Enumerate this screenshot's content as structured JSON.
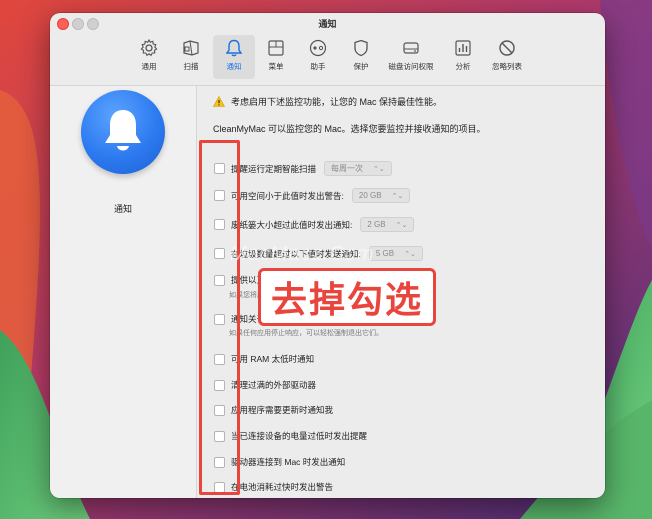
{
  "window": {
    "title": "通知"
  },
  "toolbar": {
    "items": [
      {
        "label": "通用",
        "icon": "gear-icon"
      },
      {
        "label": "扫描",
        "icon": "scan-icon"
      },
      {
        "label": "通知",
        "icon": "bell-icon",
        "active": true
      },
      {
        "label": "菜单",
        "icon": "menu-icon"
      },
      {
        "label": "助手",
        "icon": "assistant-icon"
      },
      {
        "label": "保护",
        "icon": "shield-icon"
      },
      {
        "label": "磁盘访问权限",
        "icon": "disk-icon"
      },
      {
        "label": "分析",
        "icon": "chart-icon"
      },
      {
        "label": "忽略列表",
        "icon": "prohibit-icon"
      }
    ],
    "accent_color": "#1a6fe0"
  },
  "sidebar": {
    "title": "通知",
    "icon": "bell-icon"
  },
  "content": {
    "warning": "考虑启用下述监控功能，让您的 Mac 保持最佳性能。",
    "description": "CleanMyMac 可以监控您的 Mac。选择您要监控并接收通知的项目。",
    "options": [
      {
        "label": "提醒运行定期智能扫描",
        "select": "每周一次"
      },
      {
        "label": "可用空间小于此值时发出警告:",
        "select": "20 GB"
      },
      {
        "label": "废纸篓大小超过此值时发出通知:",
        "select": "2 GB"
      },
      {
        "label": "在垃圾数量超过以下值时发送通知:",
        "select": "5 GB"
      },
      {
        "label": "提供以正确卸载应用程序",
        "sub": "如果您将应用程序拖到废纸篓，我们会帮助您以正确卸载。"
      },
      {
        "label": "通知关于",
        "sub": "如果任何应用停止响应，可以轻松强制退出它们。"
      },
      {
        "label": "可用 RAM 太低时通知"
      },
      {
        "label": "清理过满的外部驱动器"
      },
      {
        "label": "应用程序需要更新时通知我"
      },
      {
        "label": "当已连接设备的电量过低时发出提醒"
      },
      {
        "label": "驱动器连接到 Mac 时发出通知"
      },
      {
        "label": "在电池消耗过快时发出警告"
      }
    ]
  },
  "overlay": {
    "watermark": "MacMacz.Com",
    "annotation": "去掉勾选",
    "highlight_color": "#e8453c"
  }
}
